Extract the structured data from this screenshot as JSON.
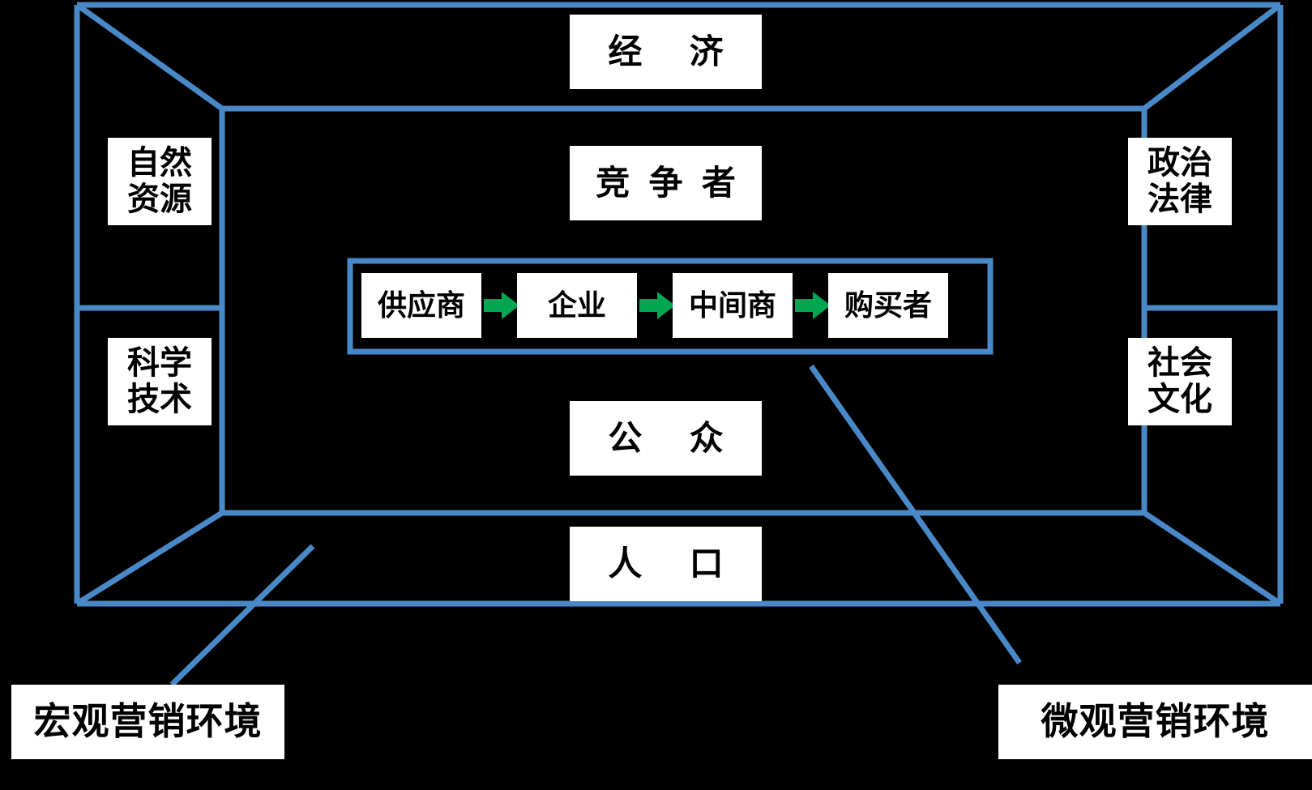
{
  "diagram": {
    "title_hidden": "",
    "colors": {
      "background": "#000000",
      "frame_line": "#4A89C8",
      "arrow_green": "#00A650",
      "box_fill": "#FFFFFF",
      "box_text": "#000000"
    }
  },
  "macro_environment": {
    "top": {
      "label": "经     济"
    },
    "left": [
      {
        "label": "自然\n资源"
      },
      {
        "label": "科学\n技术"
      }
    ],
    "right": [
      {
        "label": "政治\n法律"
      },
      {
        "label": "社会\n文化"
      }
    ],
    "bottom": {
      "label": "人     口"
    }
  },
  "micro_environment": {
    "competitors": {
      "label": "竞  争  者"
    },
    "public": {
      "label": "公     众"
    },
    "value_chain": {
      "nodes": [
        {
          "label": "供应商"
        },
        {
          "label": "企业"
        },
        {
          "label": "中间商"
        },
        {
          "label": "购买者"
        }
      ],
      "arrows": [
        {
          "name": "arrow-supplier-to-enterprise",
          "glyph": "→"
        },
        {
          "name": "arrow-enterprise-to-distributor",
          "glyph": "→"
        },
        {
          "name": "arrow-distributor-to-buyer",
          "glyph": "→"
        }
      ]
    }
  },
  "callouts": {
    "macro": {
      "label": "宏观营销环境"
    },
    "micro": {
      "label": "微观营销环境"
    }
  }
}
